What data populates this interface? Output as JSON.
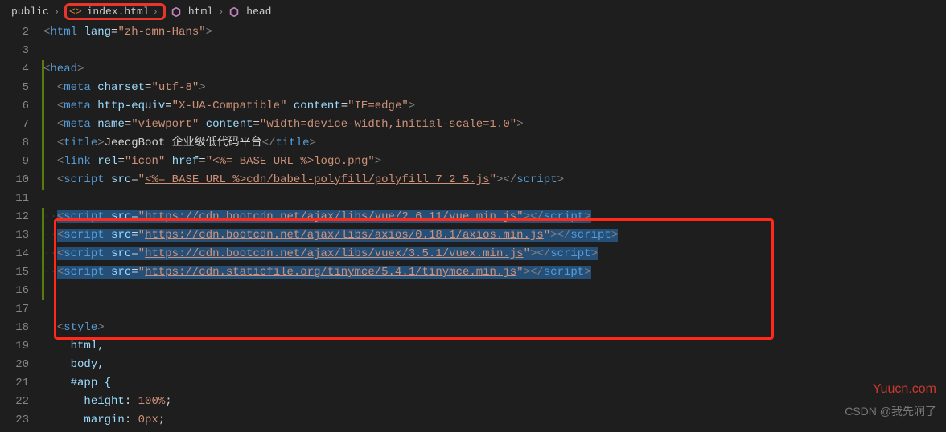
{
  "breadcrumb": {
    "items": [
      "public",
      "index.html",
      "html",
      "head"
    ]
  },
  "gutter": {
    "start": 2,
    "end": 23
  },
  "code": {
    "l2": {
      "pre": "",
      "tag": "html",
      "attrs": [
        {
          "n": "lang",
          "v": "zh-cmn-Hans"
        }
      ]
    },
    "l4": {
      "pre": "",
      "tag": "head"
    },
    "l5": {
      "pre": "  ",
      "tag": "meta",
      "attrs": [
        {
          "n": "charset",
          "v": "utf-8"
        }
      ]
    },
    "l6": {
      "pre": "  ",
      "tag": "meta",
      "attrs": [
        {
          "n": "http-equiv",
          "v": "X-UA-Compatible"
        },
        {
          "n": "content",
          "v": "IE=edge"
        }
      ]
    },
    "l7": {
      "pre": "  ",
      "tag": "meta",
      "attrs": [
        {
          "n": "name",
          "v": "viewport"
        },
        {
          "n": "content",
          "v": "width=device-width,initial-scale=1.0"
        }
      ]
    },
    "l8": {
      "pre": "  ",
      "tag": "title",
      "text": "JeecgBoot 企业级低代码平台",
      "close": "title"
    },
    "l9": {
      "pre": "  ",
      "tag": "link",
      "attrs": [
        {
          "n": "rel",
          "v": "icon"
        },
        {
          "n": "href",
          "parts": [
            "<%= BASE_URL %>",
            "logo.png"
          ],
          "ul": [
            true,
            false
          ]
        }
      ]
    },
    "l10": {
      "pre": "  ",
      "tag": "script",
      "attrs": [
        {
          "n": "src",
          "parts": [
            "<%= BASE_URL %>",
            "cdn/babel-polyfill/polyfill_7_2_5.js"
          ],
          "ul": [
            true,
            true
          ]
        }
      ],
      "close": "script"
    },
    "l12": {
      "pre": "  ",
      "tag": "script",
      "attrs": [
        {
          "n": "src",
          "v": "https://cdn.bootcdn.net/ajax/libs/vue/2.6.11/vue.min.js",
          "url": true
        }
      ],
      "close": "script",
      "sel": true,
      "dots": true
    },
    "l13": {
      "pre": "  ",
      "tag": "script",
      "attrs": [
        {
          "n": "src",
          "v": "https://cdn.bootcdn.net/ajax/libs/axios/0.18.1/axios.min.js",
          "url": true
        }
      ],
      "close": "script",
      "sel": true,
      "dots": true
    },
    "l14": {
      "pre": "  ",
      "tag": "script",
      "attrs": [
        {
          "n": "src",
          "v": "https://cdn.bootcdn.net/ajax/libs/vuex/3.5.1/vuex.min.js",
          "url": true
        }
      ],
      "close": "script",
      "sel": true,
      "dots": true
    },
    "l15": {
      "pre": "  ",
      "tag": "script",
      "attrs": [
        {
          "n": "src",
          "v": "https://cdn.staticfile.org/tinymce/5.4.1/tinymce.min.js",
          "url": true
        }
      ],
      "close": "script",
      "sel": true,
      "dots": true
    },
    "l18": {
      "pre": "  ",
      "tag": "style"
    },
    "l19": {
      "pre": "    ",
      "plain": "html,"
    },
    "l20": {
      "pre": "    ",
      "plain": "body,"
    },
    "l21": {
      "pre": "    ",
      "plain": "#app {"
    },
    "l22": {
      "pre": "      ",
      "attrline": {
        "k": "height",
        "v": "100%"
      }
    },
    "l23": {
      "pre": "      ",
      "attrline": {
        "k": "margin",
        "v": "0px"
      }
    }
  },
  "watermarks": {
    "w1": "Yuucn.com",
    "w2": "CSDN @我先润了"
  }
}
